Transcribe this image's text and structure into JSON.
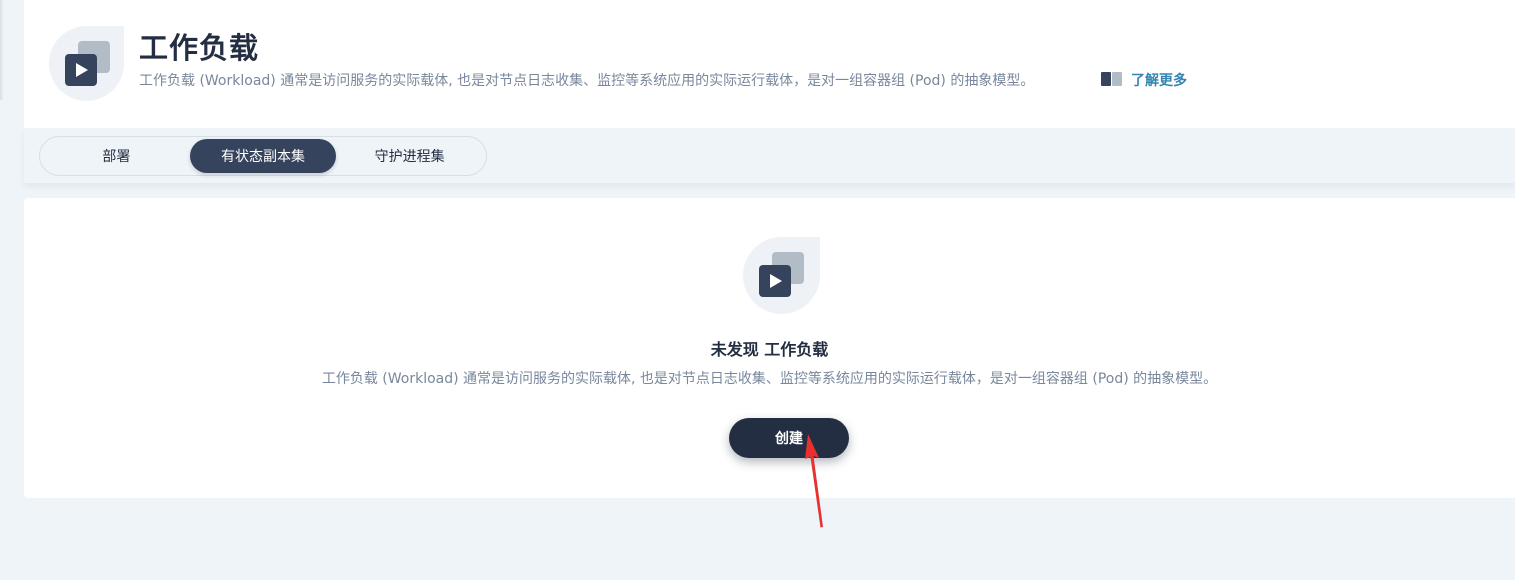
{
  "header": {
    "title": "工作负载",
    "description": "工作负载 (Workload) 通常是访问服务的实际载体, 也是对节点日志收集、监控等系统应用的实际运行载体，是对一组容器组 (Pod) 的抽象模型。",
    "learn_more": "了解更多",
    "icon": "workload-icon",
    "learn_more_icon": "book-icon"
  },
  "tabs": [
    {
      "label": "部署",
      "active": false
    },
    {
      "label": "有状态副本集",
      "active": true
    },
    {
      "label": "守护进程集",
      "active": false
    }
  ],
  "empty_state": {
    "icon": "workload-icon",
    "title": "未发现 工作负载",
    "description": "工作负载 (Workload) 通常是访问服务的实际载体, 也是对节点日志收集、监控等系统应用的实际运行载体，是对一组容器组 (Pod) 的抽象模型。",
    "create_label": "创建"
  },
  "colors": {
    "page_bg": "#eff4f9",
    "primary_dark": "#242e42",
    "active_tab": "#36435c",
    "muted_text": "#79879c",
    "link": "#3385b0",
    "annotation": "#e8302f"
  }
}
